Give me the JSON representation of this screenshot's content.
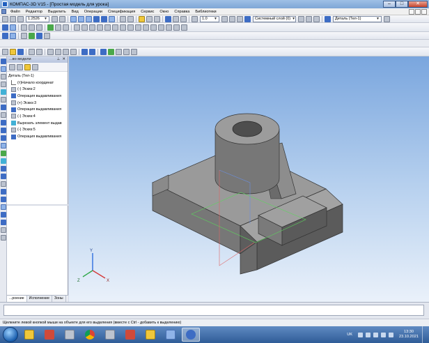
{
  "window": {
    "title": "КОМПАС-3D V15 - [Простая модель для урока]",
    "minimize": "–",
    "maximize": "□",
    "close": "✕"
  },
  "menu": [
    "Файл",
    "Редактор",
    "Выделить",
    "Вид",
    "Операции",
    "Спецификация",
    "Сервис",
    "Окно",
    "Справка",
    "Библиотеки"
  ],
  "toolbar": {
    "zoom_value": "1.2526",
    "step_value": "1.0",
    "layer": "Системный слой (0)",
    "detail_name": "Деталь (Тел-1)"
  },
  "tree": {
    "header": "...во модели",
    "root": "Деталь (Тел-1)",
    "items": [
      {
        "label": "(т)Начало координат",
        "icon": "axis-icon"
      },
      {
        "label": "(-) Эскиз:2",
        "icon": "sketch-icon"
      },
      {
        "label": "Операция выдавливания",
        "icon": "extrude-icon"
      },
      {
        "label": "(+) Эскиз:3",
        "icon": "sketch-icon"
      },
      {
        "label": "Операция выдавливания",
        "icon": "extrude-icon"
      },
      {
        "label": "(-) Эскиз:4",
        "icon": "sketch-icon"
      },
      {
        "label": "Вырезать элемент выдав",
        "icon": "cut-extrude-icon"
      },
      {
        "label": "(-) Эскиз:5",
        "icon": "sketch-icon"
      },
      {
        "label": "Операция выдавливания",
        "icon": "extrude-icon"
      }
    ],
    "tabs": [
      "...роение",
      "Исполнение",
      "Зоны"
    ]
  },
  "viewport": {
    "axis_x": "X",
    "axis_y": "Y",
    "axis_z": "Z",
    "colors": {
      "face_top": "#9a9a9a",
      "face_side": "#6e6e6e",
      "face_dark": "#555555"
    }
  },
  "status": "Щелкните левой кнопкой мыши на объекте для его выделения (вместе с Ctrl - добавить к выделению)",
  "taskbar": {
    "lang": "UK",
    "time": "13:30",
    "date": "23.10.2021"
  }
}
